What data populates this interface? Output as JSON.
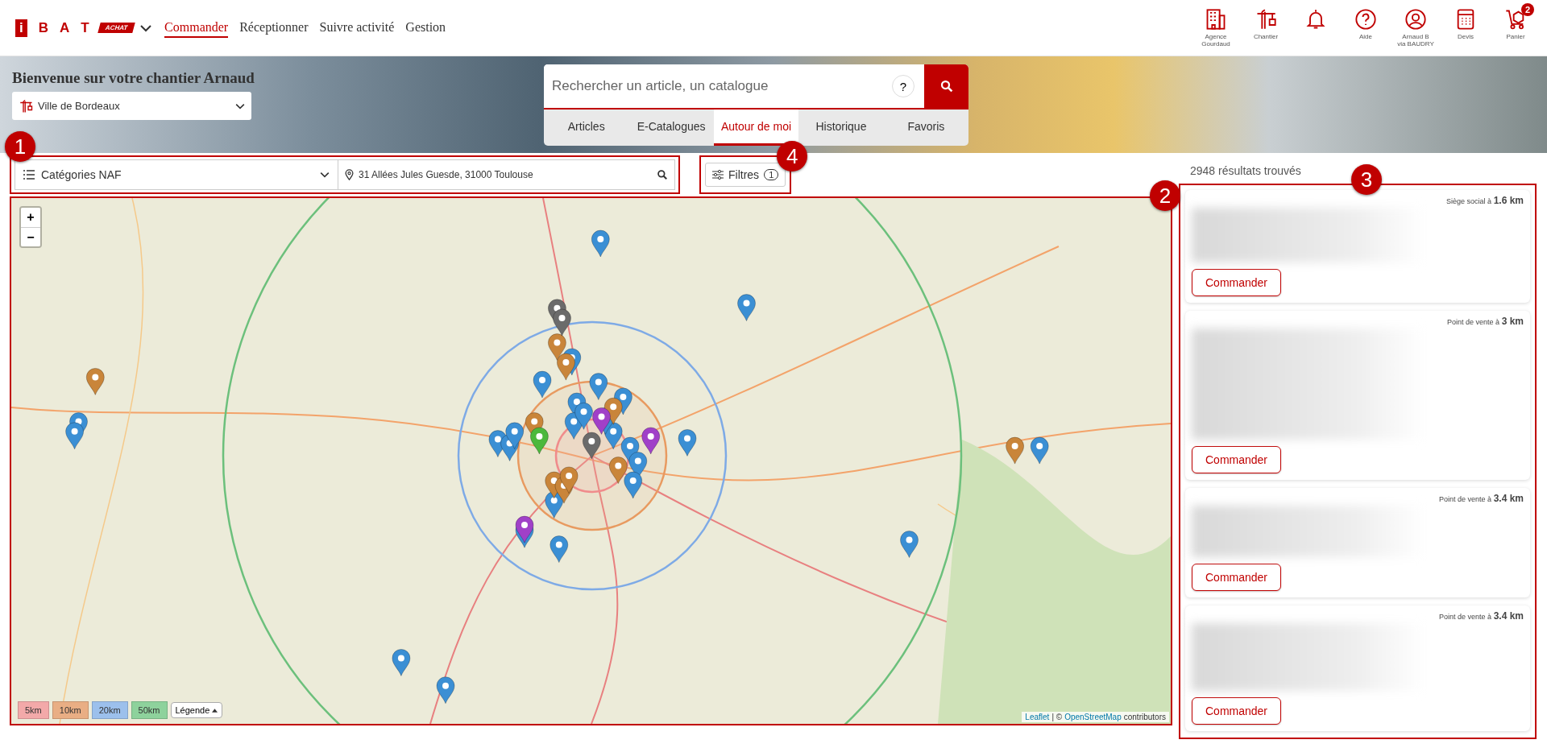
{
  "header": {
    "logo_letters": [
      "i",
      "B",
      "A",
      "T"
    ],
    "logo_badge": "ACHAT",
    "nav": [
      {
        "label": "Commander",
        "selected": true
      },
      {
        "label": "Réceptionner",
        "selected": false
      },
      {
        "label": "Suivre activité",
        "selected": false
      },
      {
        "label": "Gestion",
        "selected": false
      }
    ],
    "actions": [
      {
        "kind": "agency",
        "lines": [
          "Agence",
          "Gourdaud"
        ]
      },
      {
        "kind": "site",
        "lines": [
          "Chantier"
        ]
      },
      {
        "kind": "notifications"
      },
      {
        "kind": "help",
        "lines": [
          "Aide"
        ]
      },
      {
        "kind": "account",
        "lines": [
          "Arnaud B"
        ],
        "sub": "via BAUDRY"
      },
      {
        "kind": "quote",
        "lines": [
          "Devis"
        ]
      },
      {
        "kind": "cart",
        "lines": [
          "Panier"
        ],
        "badge": "2"
      }
    ]
  },
  "welcome": {
    "title": "Bienvenue sur votre chantier Arnaud",
    "site_select": "Ville de Bordeaux"
  },
  "search": {
    "placeholder": "Rechercher un article, un catalogue",
    "help": "?",
    "tabs": [
      {
        "label": "Articles",
        "selected": false
      },
      {
        "label": "E-Catalogues",
        "selected": false
      },
      {
        "label": "Autour de moi",
        "selected": true
      },
      {
        "label": "Historique",
        "selected": false
      },
      {
        "label": "Favoris",
        "selected": false
      }
    ]
  },
  "filters": {
    "callout": "1",
    "category_select": "Catégories NAF",
    "address": "31 Allées Jules Guesde, 31000 Toulouse",
    "filter_button": {
      "label": "Filtres",
      "count": "1",
      "callout": "4"
    }
  },
  "map": {
    "callout": "2",
    "zoom_in": "+",
    "zoom_out": "−",
    "radii": [
      {
        "label": "5km",
        "color": "#f3a9a9"
      },
      {
        "label": "10km",
        "color": "#e9ae84"
      },
      {
        "label": "20km",
        "color": "#9cc0ec"
      },
      {
        "label": "50km",
        "color": "#8ed29c"
      }
    ],
    "legend_button": "Légende",
    "attribution": {
      "leaflet": "Leaflet",
      "separator": "| ©",
      "osm": "OpenStreetMap",
      "suffix": "contributors"
    }
  },
  "results": {
    "count": "2948 résultats trouvés",
    "callout": "3",
    "items": [
      {
        "location": "Siège social à **1.6 km**",
        "button": "Commander"
      },
      {
        "location": "Point de vente à **3 km**",
        "button": "Commander"
      },
      {
        "location": "Point de vente à **3.4 km**",
        "button": "Commander"
      },
      {
        "location": "Point de vente à **3.4 km**",
        "button": "Commander"
      }
    ]
  }
}
